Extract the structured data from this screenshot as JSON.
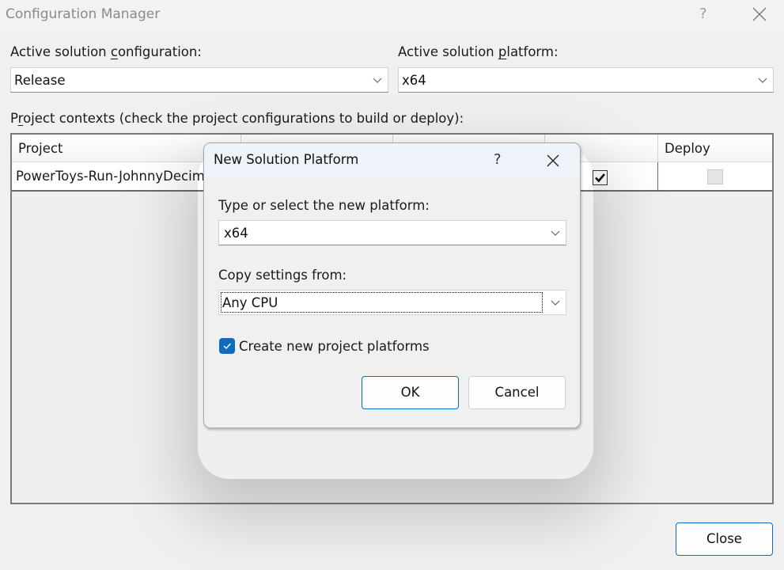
{
  "window": {
    "title": "Configuration Manager",
    "help_icon": "question-mark-icon",
    "close_icon": "close-icon"
  },
  "config": {
    "active_configuration": {
      "label_pre": "Active solution ",
      "label_accel": "c",
      "label_post": "onfiguration:",
      "value": "Release"
    },
    "active_platform": {
      "label_pre": "Active solution ",
      "label_accel": "p",
      "label_post": "latform:",
      "value": "x64"
    }
  },
  "project_contexts": {
    "label_pre": "P",
    "label_accel": "r",
    "label_post": "oject contexts (check the project configurations to build or deploy):",
    "columns": [
      "Project",
      "",
      "",
      "",
      "Deploy"
    ],
    "rows": [
      {
        "project": "PowerToys-Run-JohnnyDecimal",
        "build_checked": true,
        "deploy_checked": false,
        "deploy_enabled": false
      }
    ]
  },
  "close_button": {
    "label": "Close"
  },
  "dialog": {
    "title": "New Solution Platform",
    "help_label": "?",
    "new_platform": {
      "label": "Type or select the new platform:",
      "value": "x64"
    },
    "copy_settings": {
      "label": "Copy settings from:",
      "value": "Any CPU"
    },
    "create_project_platforms": {
      "label": "Create new project platforms",
      "checked": true
    },
    "ok_label": "OK",
    "cancel_label": "Cancel"
  },
  "colors": {
    "accent": "#0f6cbd",
    "background": "#f0f0f0",
    "dialog_titlebar": "#eef2f9"
  }
}
